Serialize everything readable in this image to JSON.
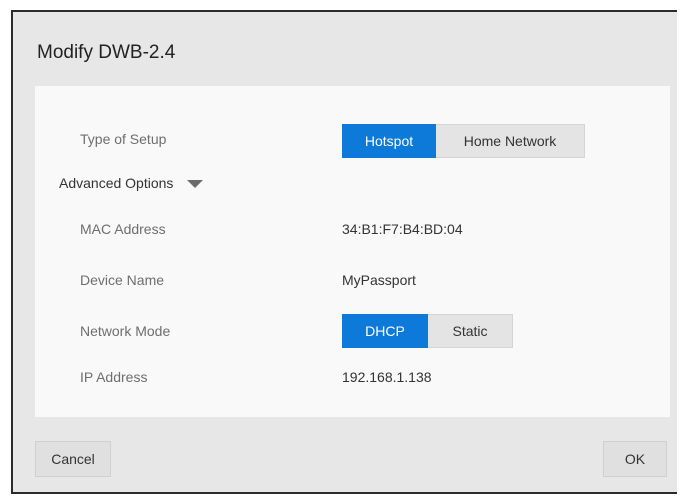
{
  "dialog": {
    "title": "Modify DWB-2.4"
  },
  "type_of_setup": {
    "label": "Type of Setup",
    "options": [
      "Hotspot",
      "Home Network"
    ],
    "selected": "Hotspot"
  },
  "advanced_options": {
    "label": "Advanced Options",
    "expanded": true
  },
  "mac_address": {
    "label": "MAC Address",
    "value": "34:B1:F7:B4:BD:04"
  },
  "device_name": {
    "label": "Device Name",
    "value": "MyPassport"
  },
  "network_mode": {
    "label": "Network Mode",
    "options": [
      "DHCP",
      "Static"
    ],
    "selected": "DHCP"
  },
  "ip_address": {
    "label": "IP Address",
    "value": "192.168.1.138"
  },
  "buttons": {
    "cancel": "Cancel",
    "ok": "OK"
  },
  "colors": {
    "accent": "#0d7ad9",
    "dialog_bg": "#e7e7e7",
    "panel_bg": "#f9f9f9"
  },
  "icons": {
    "advanced_toggle": "caret-down-icon"
  }
}
